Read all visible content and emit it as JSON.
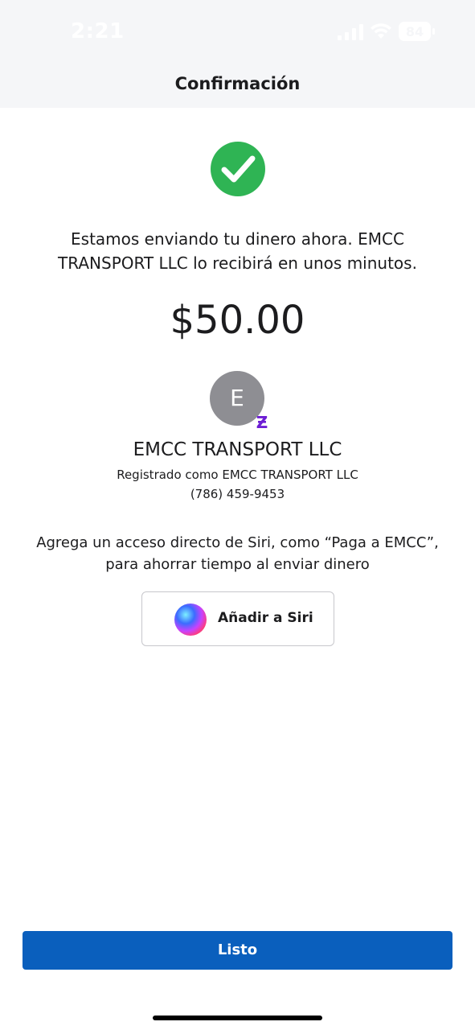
{
  "status_bar": {
    "time": "2:21",
    "battery_level": "84"
  },
  "header": {
    "title": "Confirmación"
  },
  "confirmation": {
    "message": "Estamos enviando tu dinero ahora. EMCC TRANSPORT LLC lo recibirá en unos minutos.",
    "amount": "$50.00"
  },
  "recipient": {
    "avatar_initial": "E",
    "badge_symbol": "Ƶ",
    "name": "EMCC TRANSPORT LLC",
    "registered_as": "Registrado como EMCC TRANSPORT LLC",
    "phone": "(786) 459-9453"
  },
  "siri": {
    "prompt": "Agrega un acceso directo de Siri, como “Paga a EMCC”, para ahorrar tiempo al enviar dinero",
    "button_label": "Añadir a Siri"
  },
  "footer": {
    "done_label": "Listo"
  },
  "colors": {
    "success_green": "#2fb454",
    "primary_blue": "#0a5fbd",
    "zelle_purple": "#6d1ed4",
    "avatar_gray": "#8e8e93"
  }
}
